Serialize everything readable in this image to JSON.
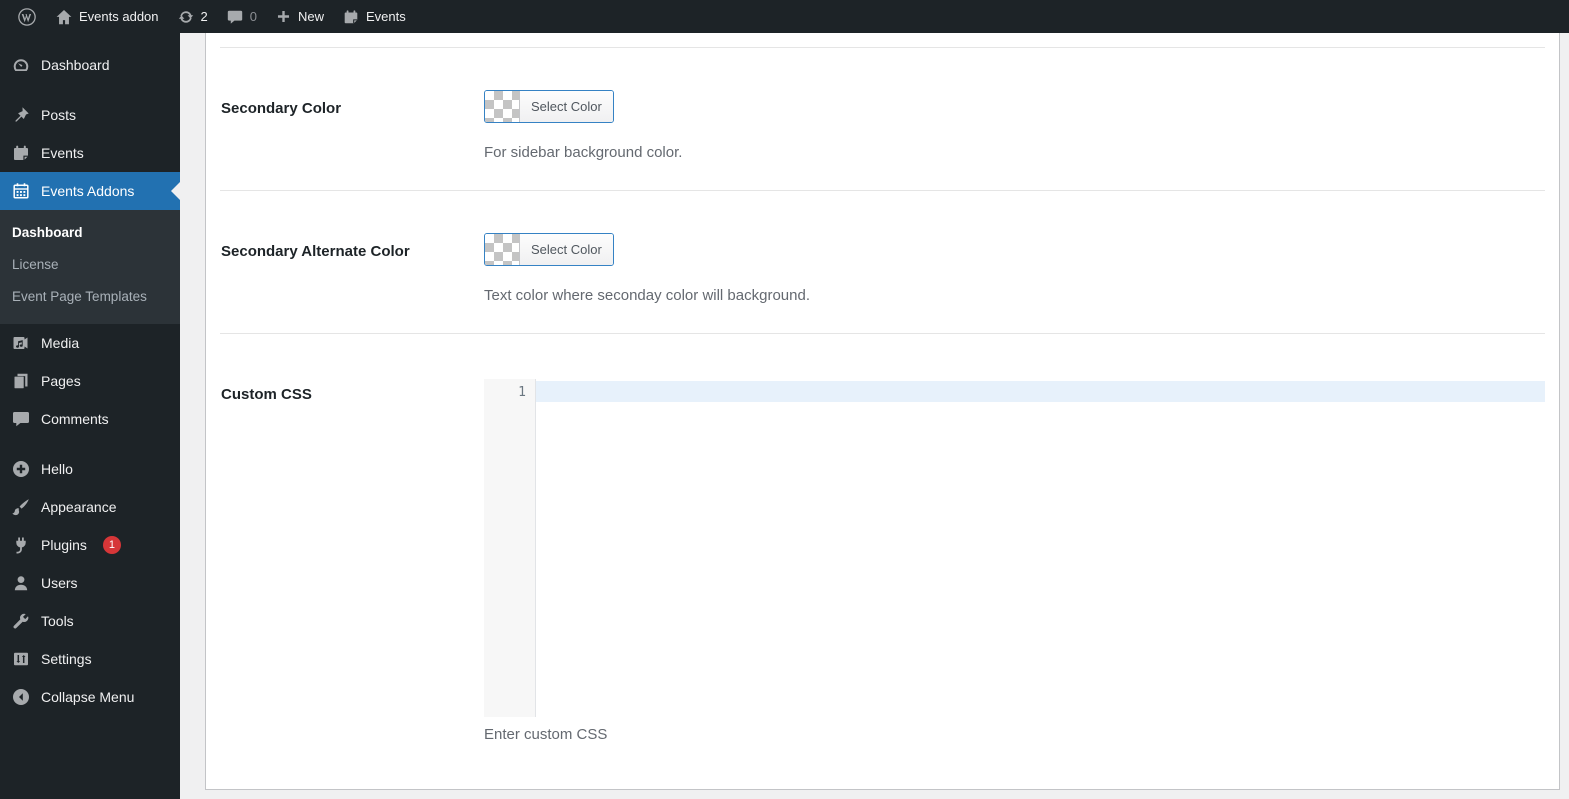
{
  "admin_bar": {
    "site_name": "Events addon",
    "updates_count": "2",
    "comments_count": "0",
    "new_label": "New",
    "events_label": "Events"
  },
  "sidebar": {
    "items": [
      {
        "label": "Dashboard",
        "icon": "dashboard-gauge"
      },
      {
        "label": "Posts",
        "icon": "pushpin"
      },
      {
        "label": "Events",
        "icon": "calendar-page"
      },
      {
        "label": "Events Addons",
        "icon": "calendar-grid",
        "active": true
      },
      {
        "label": "Media",
        "icon": "media-frame"
      },
      {
        "label": "Pages",
        "icon": "stacked-pages"
      },
      {
        "label": "Comments",
        "icon": "speech-bubble"
      },
      {
        "label": "Hello",
        "icon": "plus-circle"
      },
      {
        "label": "Appearance",
        "icon": "paint-brush"
      },
      {
        "label": "Plugins",
        "icon": "plug",
        "badge": "1"
      },
      {
        "label": "Users",
        "icon": "person"
      },
      {
        "label": "Tools",
        "icon": "wrench"
      },
      {
        "label": "Settings",
        "icon": "sliders"
      }
    ],
    "events_addons_submenu": [
      {
        "label": "Dashboard",
        "active": true
      },
      {
        "label": "License"
      },
      {
        "label": "Event Page Templates"
      }
    ],
    "collapse_label": "Collapse Menu"
  },
  "settings_panel": {
    "rows": [
      {
        "label": "Secondary Color",
        "button_label": "Select Color",
        "description": "For sidebar background color."
      },
      {
        "label": "Secondary Alternate Color",
        "button_label": "Select Color",
        "description": "Text color where seconday color will background."
      },
      {
        "label": "Custom CSS",
        "line_number": "1",
        "code_value": "",
        "description": "Enter custom CSS"
      }
    ]
  },
  "colors": {
    "admin_dark": "#1d2327",
    "submenu_bg": "#2c3338",
    "accent_blue": "#2271b1",
    "badge_red": "#d63638",
    "content_bg": "#f0f0f1",
    "active_line_blue": "#e7f1fb",
    "picker_border_blue": "#3582c4"
  }
}
